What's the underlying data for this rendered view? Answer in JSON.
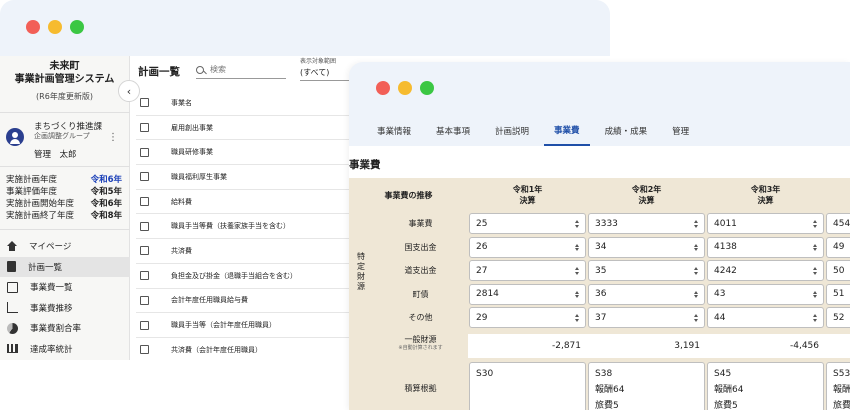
{
  "sidebar": {
    "town": "未来町",
    "system_name": "事業計画管理システム",
    "version": "(R6年度更新版)",
    "user": {
      "department": "まちづくり推進課",
      "group": "企画調整グループ",
      "name": "管理　太郎"
    },
    "years": [
      {
        "label": "実施計画年度",
        "value": "令和6年",
        "highlight": true
      },
      {
        "label": "事業評価年度",
        "value": "令和5年",
        "highlight": false
      },
      {
        "label": "実施計画開始年度",
        "value": "令和6年",
        "highlight": false
      },
      {
        "label": "実施計画終了年度",
        "value": "令和8年",
        "highlight": false
      }
    ],
    "nav": [
      {
        "label": "マイページ",
        "icon": "home-icon"
      },
      {
        "label": "計画一覧",
        "icon": "document-icon",
        "active": true
      },
      {
        "label": "事業費一覧",
        "icon": "list-icon"
      },
      {
        "label": "事業費推移",
        "icon": "line-chart-icon"
      },
      {
        "label": "事業費割合率",
        "icon": "pie-chart-icon"
      },
      {
        "label": "達成率統計",
        "icon": "bar-chart-icon"
      }
    ]
  },
  "list": {
    "title": "計画一覧",
    "search_placeholder": "検索",
    "filter_label": "表示対象範囲",
    "filter_value": "(すべて)",
    "header": "事業名",
    "rows": [
      "雇用創出事業",
      "職員研修事業",
      "職員福利厚生事業",
      "給料費",
      "職員手当等費（扶養家族手当を含む）",
      "共済費",
      "負担金及び掛金（退職手当組合を含む）",
      "会計年度任用職員給与費",
      "職員手当等（会計年度任用職員）",
      "共済費（会計年度任用職員）"
    ]
  },
  "tabs": [
    "事業情報",
    "基本事項",
    "計画説明",
    "事業費",
    "成績・成果",
    "管理"
  ],
  "active_tab": "事業費",
  "section_title": "事業費",
  "grid": {
    "corner": "事業費の推移",
    "columns": [
      {
        "year": "令和1年",
        "type": "決算"
      },
      {
        "year": "令和2年",
        "type": "決算"
      },
      {
        "year": "令和3年",
        "type": "決算"
      },
      {
        "year": "",
        "type": ""
      }
    ],
    "side_label": "特定財源",
    "rows": [
      {
        "label": "事業費",
        "values": [
          "25",
          "3333",
          "4011",
          "454"
        ]
      },
      {
        "label": "国支出金",
        "values": [
          "26",
          "34",
          "4138",
          "49"
        ]
      },
      {
        "label": "道支出金",
        "values": [
          "27",
          "35",
          "4242",
          "50"
        ]
      },
      {
        "label": "町債",
        "values": [
          "2814",
          "36",
          "43",
          "51"
        ]
      },
      {
        "label": "その他",
        "values": [
          "29",
          "37",
          "44",
          "52"
        ]
      }
    ],
    "general": {
      "label": "一般財源",
      "sub": "※自動計算されます",
      "values": [
        "-2,871",
        "3,191",
        "-4,456",
        ""
      ]
    },
    "basis": {
      "label": "積算根拠",
      "values": [
        [
          "S30"
        ],
        [
          "S38",
          "報酬64",
          "旅費5"
        ],
        [
          "S45",
          "報酬64",
          "旅費5"
        ],
        [
          "S53",
          "報酬",
          "旅費"
        ]
      ]
    }
  }
}
